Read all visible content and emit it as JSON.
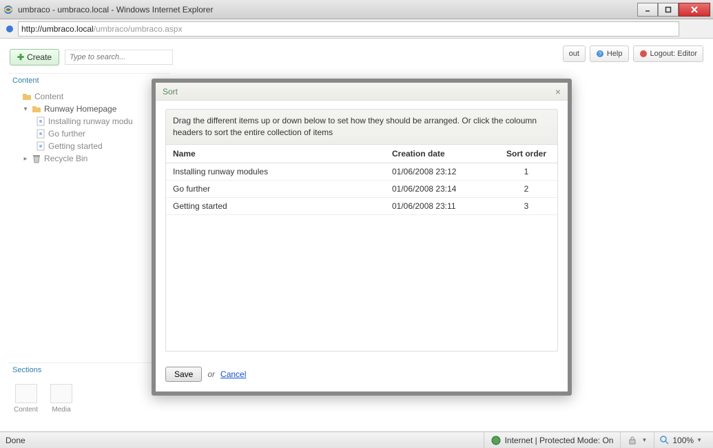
{
  "window": {
    "title": "umbraco - umbraco.local - Windows Internet Explorer",
    "url_proto_host": "http://umbraco.local",
    "url_path": "/umbraco/umbraco.aspx"
  },
  "toolbar": {
    "create_label": "Create",
    "search_placeholder": "Type to search...",
    "about_label": "out",
    "help_label": "Help",
    "logout_label": "Logout: Editor"
  },
  "tree": {
    "panel_title": "Content",
    "items": [
      {
        "label": "Content",
        "depth": 0,
        "icon": "folder-icon"
      },
      {
        "label": "Runway Homepage",
        "depth": 1,
        "icon": "folder-icon"
      },
      {
        "label": "Installing runway modu",
        "depth": 2,
        "icon": "doc-icon"
      },
      {
        "label": "Go further",
        "depth": 2,
        "icon": "doc-icon"
      },
      {
        "label": "Getting started",
        "depth": 2,
        "icon": "doc-icon"
      },
      {
        "label": "Recycle Bin",
        "depth": 1,
        "icon": "bin-icon"
      }
    ]
  },
  "sections": {
    "panel_title": "Sections",
    "items": [
      {
        "label": "Content"
      },
      {
        "label": "Media"
      }
    ]
  },
  "modal": {
    "title": "Sort",
    "instructions": "Drag the different items up or down below to set how they should be arranged. Or click the coloumn headers to sort the entire collection of items",
    "columns": {
      "name": "Name",
      "date": "Creation date",
      "order": "Sort order"
    },
    "rows": [
      {
        "name": "Installing runway modules",
        "date": "01/06/2008 23:12",
        "order": "1"
      },
      {
        "name": "Go further",
        "date": "01/06/2008 23:14",
        "order": "2"
      },
      {
        "name": "Getting started",
        "date": "01/06/2008 23:11",
        "order": "3"
      }
    ],
    "save_label": "Save",
    "or_text": "or",
    "cancel_label": "Cancel"
  },
  "statusbar": {
    "done": "Done",
    "zone": "Internet | Protected Mode: On",
    "zoom": "100%"
  }
}
